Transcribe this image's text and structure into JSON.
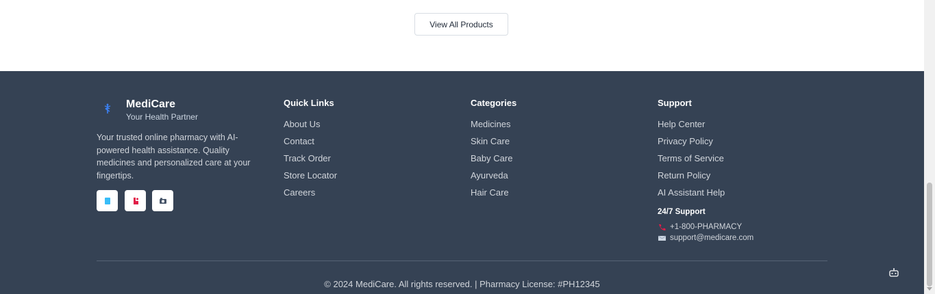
{
  "products": {
    "view_all_label": "View All Products"
  },
  "brand": {
    "name": "MediCare",
    "tagline": "Your Health Partner",
    "description": "Your trusted online pharmacy with AI-powered health assistance. Quality medicines and personalized care at your fingertips.",
    "icon": "caduceus-icon",
    "socials": [
      {
        "name": "facebook-icon",
        "color": "#38bdf8"
      },
      {
        "name": "instagram-icon",
        "color": "#e11d48"
      },
      {
        "name": "youtube-icon",
        "color": "#475569"
      }
    ]
  },
  "quick_links": {
    "title": "Quick Links",
    "items": [
      "About Us",
      "Contact",
      "Track Order",
      "Store Locator",
      "Careers"
    ]
  },
  "categories": {
    "title": "Categories",
    "items": [
      "Medicines",
      "Skin Care",
      "Baby Care",
      "Ayurveda",
      "Hair Care"
    ]
  },
  "support": {
    "title": "Support",
    "items": [
      "Help Center",
      "Privacy Policy",
      "Terms of Service",
      "Return Policy",
      "AI Assistant Help"
    ],
    "hotline_title": "24/7 Support",
    "phone": "+1-800-PHARMACY",
    "email": "support@medicare.com"
  },
  "footer": {
    "copyright": "© 2024 MediCare. All rights reserved. | Pharmacy License: #PH12345",
    "bg_color": "#354254"
  }
}
